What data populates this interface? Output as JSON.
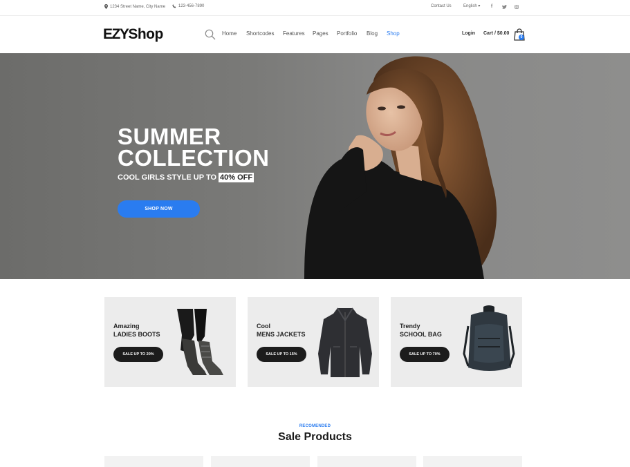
{
  "topbar": {
    "address": "1234 Street Name, City Name",
    "phone": "123-456-7890",
    "contact": "Contact Us",
    "language": "English ▾",
    "social": [
      "f",
      "t",
      "◎"
    ]
  },
  "header": {
    "logo_part1": "EZY",
    "logo_part2": "Shop",
    "nav": [
      "Home",
      "Shortcodes",
      "Features",
      "Pages",
      "Portfolio",
      "Blog",
      "Shop"
    ],
    "active_nav": "Shop",
    "login": "Login",
    "cart": "Cart / $0.00",
    "cart_count": "0"
  },
  "hero": {
    "title_line1": "SUMMER",
    "title_line2": "COLLECTION",
    "subtitle": "COOL GIRLS STYLE UP TO",
    "discount": "40% OFF",
    "cta": "SHOP NOW"
  },
  "categories": [
    {
      "line1": "Amazing",
      "line2": "LADIES BOOTS",
      "cta": "SALE UP TO 20%",
      "icon": "boots-icon"
    },
    {
      "line1": "Cool",
      "line2": "MENS JACKETS",
      "cta": "SALE UP TO 15%",
      "icon": "jacket-icon"
    },
    {
      "line1": "Trendy",
      "line2": "SCHOOL BAG",
      "cta": "SALE UP TO 70%",
      "icon": "backpack-icon"
    }
  ],
  "recommended": {
    "label": "RECOMENDED",
    "title": "Sale Products"
  },
  "colors": {
    "accent": "#2a7cf0",
    "dark": "#1c1c1c",
    "hero_bg": "#7a7a78",
    "card_bg": "#ececec"
  }
}
